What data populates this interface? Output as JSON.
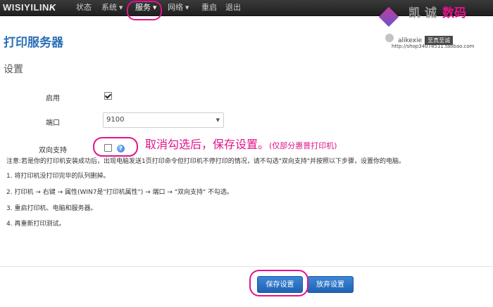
{
  "brand": {
    "logo_text": "WISIYILIN",
    "logo_k": "K"
  },
  "nav": {
    "items": [
      {
        "label": "状态",
        "dropdown": false
      },
      {
        "label": "系统",
        "dropdown": true
      },
      {
        "label": "服务",
        "dropdown": true
      },
      {
        "label": "网络",
        "dropdown": true
      },
      {
        "label": "重启",
        "dropdown": false
      },
      {
        "label": "退出",
        "dropdown": false
      }
    ]
  },
  "page": {
    "title": "打印服务器",
    "section_title": "设置"
  },
  "form": {
    "enable": {
      "label": "启用",
      "checked": true
    },
    "port": {
      "label": "端口",
      "value": "9100"
    },
    "bidirectional": {
      "label": "双向支持",
      "checked": false,
      "help_icon": "question-icon"
    }
  },
  "annotation": {
    "main": "取消勾选后，保存设置。",
    "sub": "(仅部分惠普打印机)",
    "color": "#e0148a"
  },
  "notes": [
    "注意:若是你的打印机安装成功后，出现电脑发送1页打印命令但打印机不停打印的情况，请不勾选\"双向支持\"并按照以下步骤，设置你的电脑。",
    "1. 将打印机没打印完毕的队列删掉。",
    "2. 打印机 → 右键 → 属性(WIN7是\"打印机属性\") → 端口 → \"双向支持\" 不勾选。",
    "3. 重启打印机、电脑和服务器。",
    "4. 再重新打印测试。"
  ],
  "buttons": {
    "save": "保存设置",
    "discard": "放弃设置"
  },
  "watermark": {
    "cn1": "凯",
    "cn2": "诚",
    "cn3": "数",
    "cn4": "码",
    "id": "alikexie",
    "tag": "至真至诚",
    "url": "http://shop34078511.taobao.com"
  },
  "colors": {
    "accent": "#2a6fb5",
    "button": "#2e75c8",
    "highlight": "#e0148a"
  }
}
